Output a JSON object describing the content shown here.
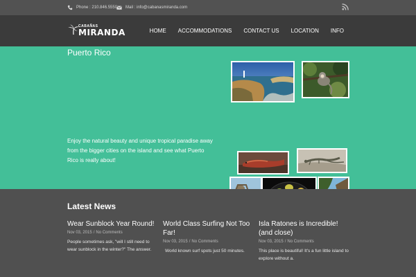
{
  "topbar": {
    "phone": "Phone : 210.846.5550",
    "email": "Mail : info@cabanasmiranda.com",
    "icons": [
      "phone-icon",
      "mail-icon",
      "rss-icon"
    ]
  },
  "logo": {
    "small": "CABAÑAS",
    "big": "MIRANDA"
  },
  "nav": [
    {
      "label": "HOME"
    },
    {
      "label": "ACCOMMODATIONS"
    },
    {
      "label": "CONTACT US"
    },
    {
      "label": "LOCATION"
    },
    {
      "label": "INFO"
    }
  ],
  "hero": {
    "title": "Puerto Rico",
    "text": "Enjoy the natural beauty and unique tropical paradise away from the bigger cities on the island and see what Puerto Rico is really about!",
    "photos": [
      "coastal-lighthouse-photo",
      "monkey-photo",
      "lizard-photo",
      "iguana-photo",
      "rocky-beach-photo",
      "mangoes-photo",
      "beach-cove-photo"
    ]
  },
  "news": {
    "heading": "Latest News",
    "posts": [
      {
        "title": "Wear Sunblock Year Round!",
        "date": "Nov 03, 2015",
        "comments": "No Comments",
        "excerpt": "People sometimes ask, \"will I still need to wear sunblock in the winter?\" The answer."
      },
      {
        "title": "World Class Surfing Not Too Far!",
        "date": "Nov 03, 2015",
        "comments": "No Comments",
        "excerpt": "World known surf spots just 50 minutes."
      },
      {
        "title": "Isla Ratones is Incredible! (and close)",
        "date": "Nov 03, 2015",
        "comments": "No Comments",
        "excerpt": "This place is beautiful! It's a fun little island to explore without a."
      }
    ]
  },
  "colors": {
    "accent": "#43bf98",
    "header": "#3b3b3b",
    "topbar": "#525252",
    "body": "#505050"
  }
}
